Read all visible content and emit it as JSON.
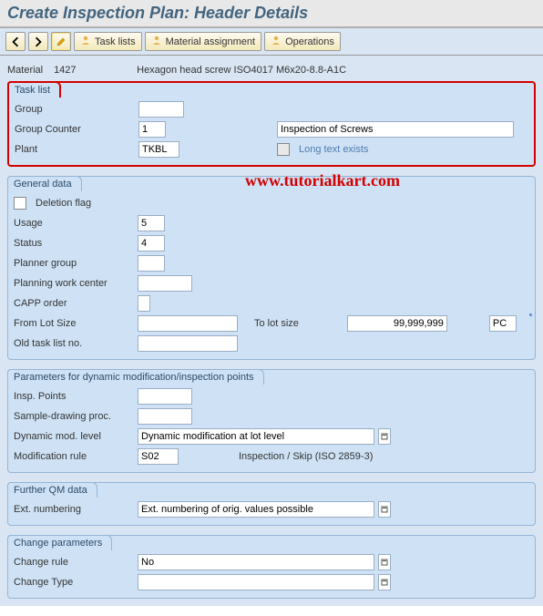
{
  "title": "Create Inspection Plan: Header Details",
  "toolbar": {
    "task_lists": "Task lists",
    "material_assignment": "Material assignment",
    "operations": "Operations"
  },
  "material": {
    "label": "Material",
    "code": "1427",
    "desc": "Hexagon head screw ISO4017 M6x20-8.8-A1C"
  },
  "task_list": {
    "title": "Task list",
    "group_lbl": "Group",
    "group": "",
    "counter_lbl": "Group Counter",
    "counter": "1",
    "desc": "Inspection of Screws",
    "plant_lbl": "Plant",
    "plant": "TKBL",
    "long_text": "Long text exists"
  },
  "general": {
    "title": "General data",
    "deletion_lbl": "Deletion flag",
    "usage_lbl": "Usage",
    "usage": "5",
    "status_lbl": "Status",
    "status": "4",
    "planner_lbl": "Planner group",
    "planner": "",
    "workcenter_lbl": "Planning work center",
    "workcenter": "",
    "capp_lbl": "CAPP order",
    "capp": "",
    "fromlot_lbl": "From Lot Size",
    "fromlot": "",
    "tolot_lbl": "To lot size",
    "tolot": "99,999,999",
    "uom": "PC",
    "oldtask_lbl": "Old task list no.",
    "oldtask": ""
  },
  "params": {
    "title": "Parameters for dynamic modification/inspection points",
    "insp_lbl": "Insp. Points",
    "insp": "",
    "sample_lbl": "Sample-drawing proc.",
    "sample": "",
    "dyn_lbl": "Dynamic mod. level",
    "dyn": "Dynamic modification at lot level",
    "mod_lbl": "Modification rule",
    "mod": "S02",
    "mod_desc": "Inspection / Skip (ISO 2859-3)"
  },
  "qm": {
    "title": "Further QM data",
    "ext_lbl": "Ext. numbering",
    "ext": "Ext. numbering of orig. values possible"
  },
  "change": {
    "title": "Change parameters",
    "rule_lbl": "Change rule",
    "rule": "No",
    "type_lbl": "Change Type",
    "type": ""
  },
  "watermark": "www.tutorialkart.com"
}
